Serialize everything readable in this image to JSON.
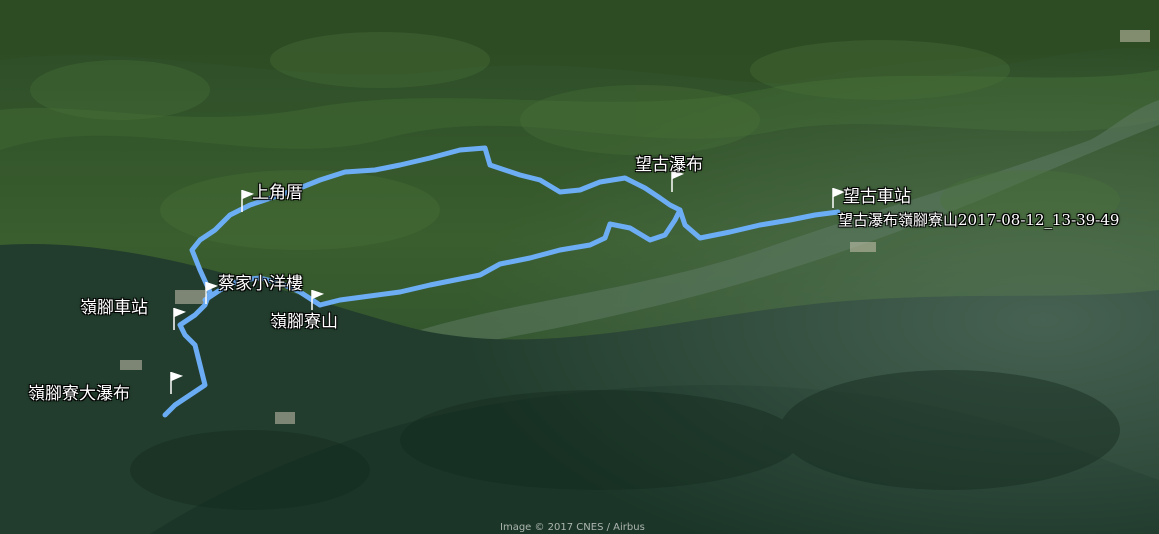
{
  "map": {
    "type": "satellite-3d",
    "track_color": "#6fb2ff",
    "places": [
      {
        "name": "上角厝",
        "icon": "flag-icon"
      },
      {
        "name": "望古瀑布",
        "icon": "flag-icon"
      },
      {
        "name": "望古車站",
        "icon": "flag-icon"
      },
      {
        "name": "望古瀑布嶺腳寮山2017-08-12_13-39-49",
        "icon": "none"
      },
      {
        "name": "蔡家小洋樓",
        "icon": "flag-icon"
      },
      {
        "name": "嶺腳車站",
        "icon": "flag-icon"
      },
      {
        "name": "嶺腳寮山",
        "icon": "flag-icon"
      },
      {
        "name": "嶺腳寮大瀑布",
        "icon": "flag-icon"
      }
    ],
    "attribution": "Image © 2017 CNES / Airbus"
  }
}
